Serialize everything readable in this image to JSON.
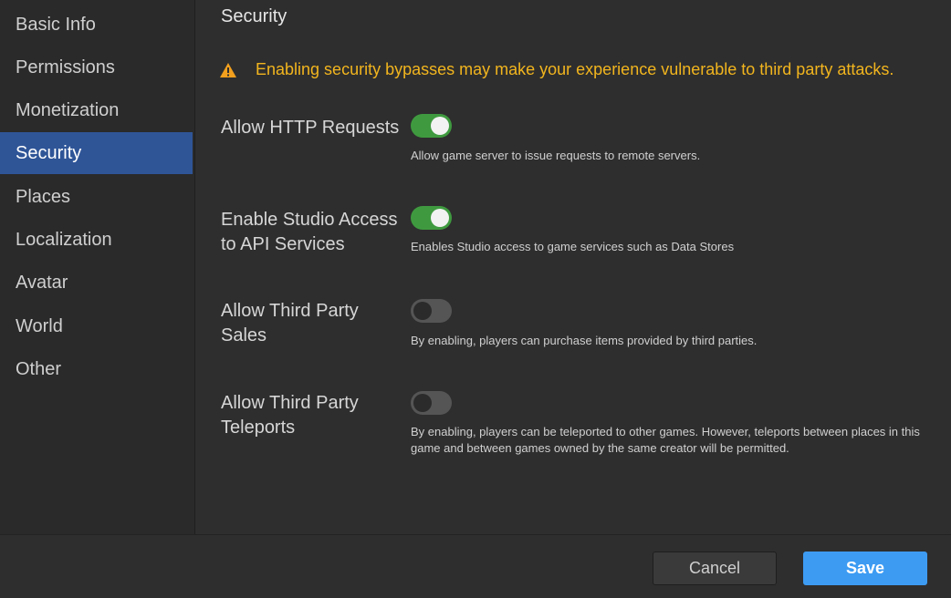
{
  "sidebar": {
    "items": [
      {
        "label": "Basic Info",
        "active": false
      },
      {
        "label": "Permissions",
        "active": false
      },
      {
        "label": "Monetization",
        "active": false
      },
      {
        "label": "Security",
        "active": true
      },
      {
        "label": "Places",
        "active": false
      },
      {
        "label": "Localization",
        "active": false
      },
      {
        "label": "Avatar",
        "active": false
      },
      {
        "label": "World",
        "active": false
      },
      {
        "label": "Other",
        "active": false
      }
    ]
  },
  "main": {
    "title": "Security",
    "warning": {
      "icon": "warning-triangle-icon",
      "text": "Enabling security bypasses may make your experience vulnerable to third party attacks."
    },
    "settings": [
      {
        "label": "Allow HTTP Requests",
        "enabled": true,
        "description": "Allow game server to issue requests to remote servers."
      },
      {
        "label": "Enable Studio Access to API Services",
        "enabled": true,
        "description": "Enables Studio access to game services such as Data Stores"
      },
      {
        "label": "Allow Third Party Sales",
        "enabled": false,
        "description": "By enabling, players can purchase items provided by third parties."
      },
      {
        "label": "Allow Third Party Teleports",
        "enabled": false,
        "description": "By enabling, players can be teleported to other games. However, teleports between places in this game and between games owned by the same creator will be permitted."
      }
    ]
  },
  "footer": {
    "cancel_label": "Cancel",
    "save_label": "Save"
  },
  "colors": {
    "accent": "#3d9bf2",
    "active_nav": "#2f5597",
    "toggle_on": "#3f9a3f",
    "warning": "#f2b51e"
  }
}
